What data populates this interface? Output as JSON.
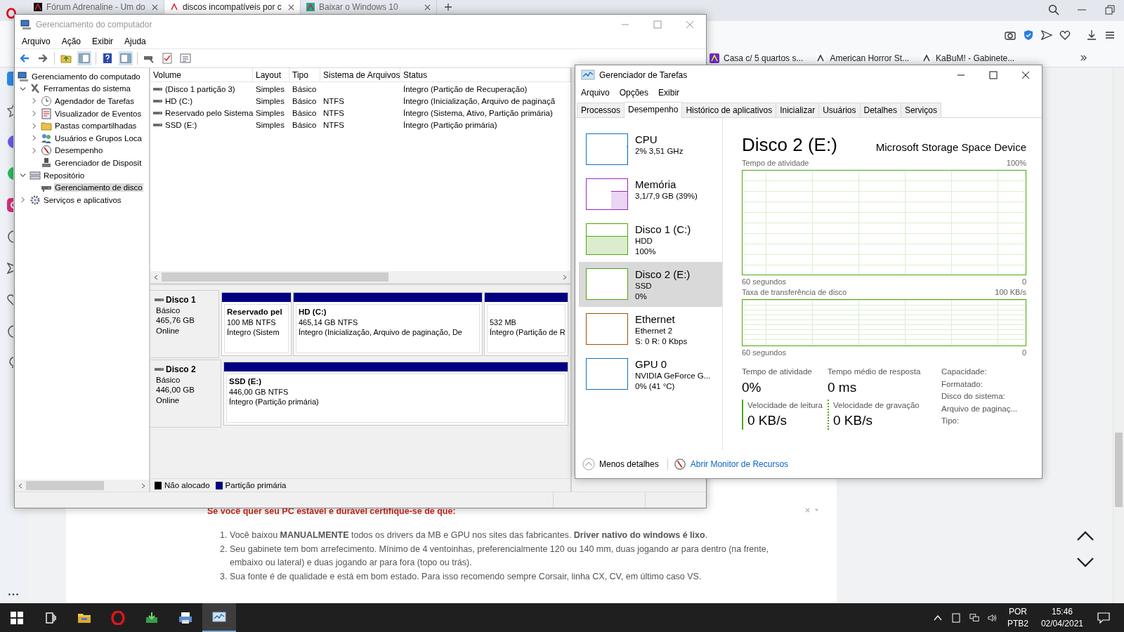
{
  "browser": {
    "tabs": [
      {
        "label": "Fórum Adrenaline - Um do",
        "selected": false
      },
      {
        "label": "discos incompatíveis por c",
        "selected": true
      },
      {
        "label": "Baixar o Windows 10",
        "selected": false
      }
    ],
    "bookmarks": [
      "Casa c/ 5 quartos s...",
      "American Horror St...",
      "KaBuM! - Gabinete..."
    ],
    "article": {
      "heading": "Se você quer seu PC estável e durável certifique-se de que:",
      "items": [
        {
          "number": "1.",
          "text": "Você baixou **MANUALMENTE** todos os drivers da MB e GPU nos sites das fabricantes. **Driver nativo do windows é lixo**."
        },
        {
          "number": "2.",
          "text": "Seu gabinete tem bom arrefecimento. Mínimo de 4 ventoinhas, preferencialmente 120 ou 140 mm, duas jogando ar para dentro (na frente, embaixo ou lateral) e duas jogando ar para fora (topo ou trás)."
        },
        {
          "number": "3.",
          "text": "Sua fonte é de qualidade e está em bom estado. Para isso recomendo sempre Corsair, linha CX, CV, em último caso VS."
        }
      ]
    }
  },
  "computer_management": {
    "title": "Gerenciamento do computador",
    "menu": [
      "Arquivo",
      "Ação",
      "Exibir",
      "Ajuda"
    ],
    "tree": [
      {
        "label": "Gerenciamento do computado",
        "selected": false,
        "children": [
          {
            "label": "Ferramentas do sistema",
            "expanded": true,
            "selected": false,
            "children": [
              {
                "label": "Agendador de Tarefas",
                "expanded": false,
                "selected": false
              },
              {
                "label": "Visualizador de Eventos",
                "expanded": false,
                "selected": false
              },
              {
                "label": "Pastas compartilhadas",
                "expanded": false,
                "selected": false
              },
              {
                "label": "Usuários e Grupos Loca",
                "expanded": false,
                "selected": false
              },
              {
                "label": "Desempenho",
                "expanded": false,
                "selected": false
              },
              {
                "label": "Gerenciador de Disposit",
                "selected": false
              }
            ]
          },
          {
            "label": "Repositório",
            "expanded": true,
            "selected": false,
            "children": [
              {
                "label": "Gerenciamento de disco",
                "selected": true
              }
            ]
          },
          {
            "label": "Serviços e aplicativos",
            "expanded": false,
            "selected": false
          }
        ]
      }
    ],
    "columns": [
      "Volume",
      "Layout",
      "Tipo",
      "Sistema de Arquivos",
      "Status"
    ],
    "volumes": [
      {
        "volume": "(Disco 1 partição 3)",
        "layout": "Simples",
        "type": "Básico",
        "status": "Íntegro (Partição de Recuperação)"
      },
      {
        "volume": "HD (C:)",
        "layout": "Simples",
        "type": "Básico",
        "file_system": "NTFS",
        "status": "Íntegro (Inicialização, Arquivo de paginaçã"
      },
      {
        "volume": "Reservado pelo Sistema",
        "layout": "Simples",
        "type": "Básico",
        "file_system": "NTFS",
        "status": "Íntegro (Sistema, Ativo, Partição primária)"
      },
      {
        "volume": "SSD (E:)",
        "layout": "Simples",
        "type": "Básico",
        "file_system": "NTFS",
        "status": "Íntegro (Partição primária)"
      }
    ],
    "disks": [
      {
        "name": "Disco 1",
        "type": "Básico",
        "size": "465,76 GB",
        "state": "Online",
        "partitions": [
          {
            "name": "Reservado pel",
            "size": "100 MB NTFS",
            "status": "Íntegro (Sistem",
            "color": "#000080"
          },
          {
            "name": "HD  (C:)",
            "size": "465,14 GB NTFS",
            "status": "Íntegro (Inicialização, Arquivo de paginação, De",
            "color": "#000080"
          },
          {
            "size": "532 MB",
            "status": "Íntegro (Partição de R",
            "color": "#000080"
          }
        ]
      },
      {
        "name": "Disco 2",
        "type": "Básico",
        "size": "446,00 GB",
        "state": "Online",
        "partitions": [
          {
            "name": "SSD  (E:)",
            "size": "446,00 GB NTFS",
            "status": "Íntegro (Partição primária)",
            "color": "#000080"
          }
        ]
      }
    ],
    "legend": [
      {
        "label": "Não alocado",
        "color": "#000000"
      },
      {
        "label": "Partição primária",
        "color": "#000080"
      }
    ]
  },
  "task_manager": {
    "title": "Gerenciador de Tarefas",
    "menu": [
      "Arquivo",
      "Opções",
      "Exibir"
    ],
    "tabs": [
      {
        "label": "Processos",
        "selected": false
      },
      {
        "label": "Desempenho",
        "selected": true
      },
      {
        "label": "Histórico de aplicativos",
        "selected": false
      },
      {
        "label": "Inicializar",
        "selected": false
      },
      {
        "label": "Usuários",
        "selected": false
      },
      {
        "label": "Detalhes",
        "selected": false
      },
      {
        "label": "Serviços",
        "selected": false
      }
    ],
    "resources": [
      {
        "name": "CPU",
        "details": [
          "2% 3,51 GHz"
        ],
        "color": "#1170c8",
        "level": 0.02,
        "selected": false
      },
      {
        "name": "Memória",
        "details": [
          "3,1/7,9 GB (39%)"
        ],
        "color": "#9b27c7",
        "level": 0.39,
        "selected": false
      },
      {
        "name": "Disco 1 (C:)",
        "details": [
          "HDD",
          "100%"
        ],
        "color": "#4da60c",
        "level": 1,
        "selected": false
      },
      {
        "name": "Disco 2 (E:)",
        "details": [
          "SSD",
          "0%"
        ],
        "color": "#4da60c",
        "selected": true
      },
      {
        "name": "Ethernet",
        "details": [
          "Ethernet 2",
          "S: 0 R: 0 Kbps"
        ],
        "color": "#a74f01",
        "selected": false
      },
      {
        "name": "GPU 0",
        "details": [
          "NVIDIA GeForce G...",
          "0%  (41 °C)"
        ],
        "color": "#1170c8",
        "selected": false
      }
    ],
    "detail": {
      "title": "Disco 2 (E:)",
      "device": "Microsoft Storage Space Device",
      "graphs": [
        {
          "label": "Tempo de atividade",
          "max": "100%",
          "time": "60 segundos",
          "min": "0"
        },
        {
          "label": "Taxa de transferência de disco",
          "max": "100 KB/s",
          "time": "60 segundos",
          "min": "0"
        }
      ],
      "stats": [
        {
          "label": "Tempo de atividade",
          "value": "0%"
        },
        {
          "label": "Tempo médio de resposta",
          "value": "0 ms"
        }
      ],
      "speeds": [
        {
          "label": "Velocidade de leitura",
          "value": "0 KB/s",
          "kind": "solid"
        },
        {
          "label": "Velocidade de gravação",
          "value": "0 KB/s",
          "kind": "dotted"
        }
      ],
      "properties": [
        "Capacidade:",
        "Formatado:",
        "Disco do sistema:",
        "Arquivo de paginaç...",
        "Tipo:"
      ]
    },
    "footer": {
      "less_details": "Menos detalhes",
      "monitor_link": "Abrir Monitor de Recursos"
    }
  },
  "taskbar": {
    "apps": [
      {
        "kind": "taskview",
        "selected": false
      },
      {
        "kind": "folder",
        "selected": false
      },
      {
        "kind": "ring",
        "selected": false
      },
      {
        "kind": "installer",
        "selected": false
      },
      {
        "kind": "printer",
        "selected": false
      },
      {
        "kind": "monitor",
        "selected": true
      }
    ],
    "language": "POR",
    "layout": "PTB2",
    "time": "15:46",
    "date": "02/04/2021"
  }
}
